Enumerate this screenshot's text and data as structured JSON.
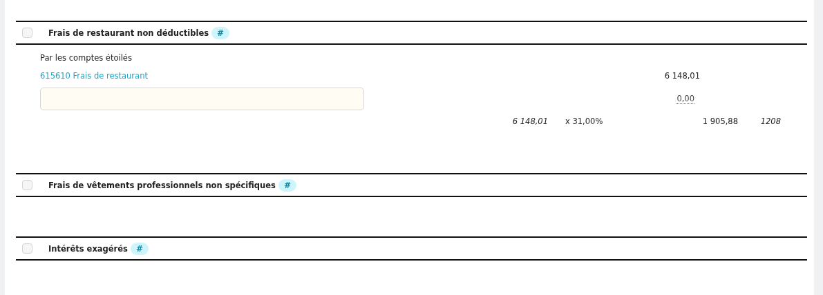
{
  "sections": [
    {
      "title": "Frais de restaurant non déductibles",
      "checked": false,
      "tag": "#",
      "body": {
        "caption": "Par les comptes étoilés",
        "accounts": [
          {
            "label": "615610 Frais de restaurant",
            "amount": "6 148,01"
          }
        ],
        "input": {
          "amount": "0,00"
        },
        "total": {
          "base": "6 148,01",
          "rate": "x 31,00%",
          "result": "1 905,88",
          "ref": "1208"
        }
      }
    },
    {
      "title": "Frais de vêtements professionnels non spécifiques",
      "checked": false,
      "tag": "#"
    },
    {
      "title": "Intérêts exagérés",
      "checked": false,
      "tag": "#"
    }
  ]
}
